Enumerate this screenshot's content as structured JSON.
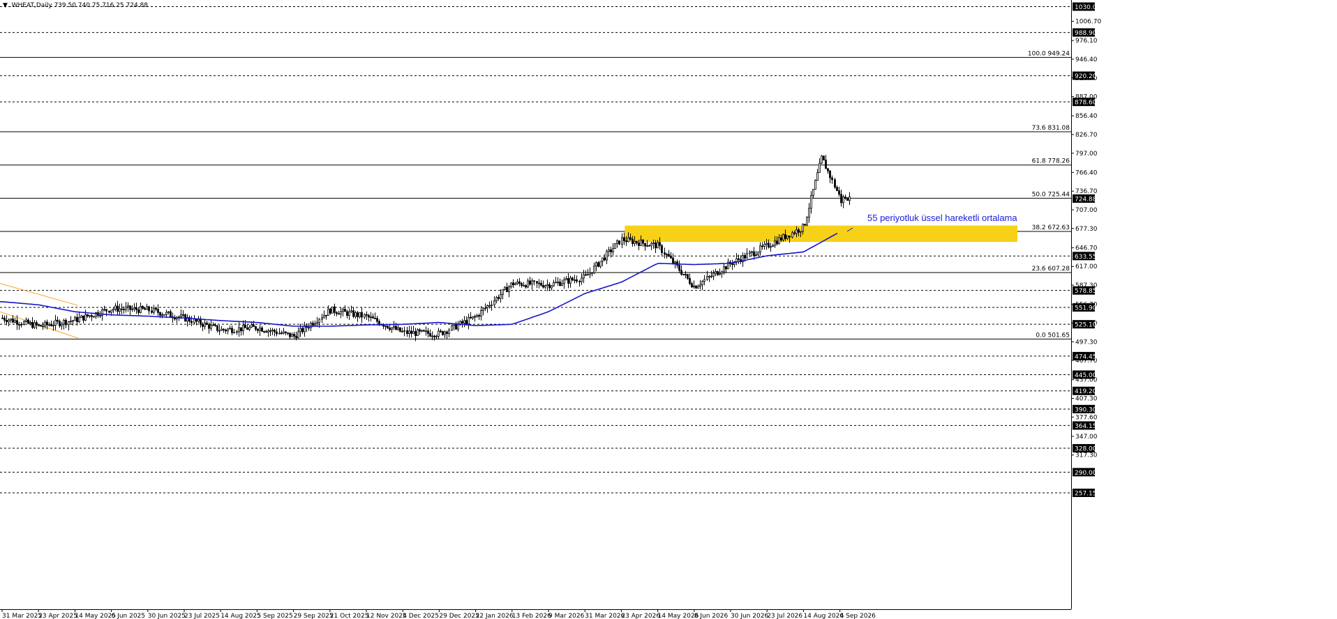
{
  "header": {
    "symbol_text": "▼ .WHEAT,Daily  739.50 740.75 716.25 724.88"
  },
  "colors": {
    "candle": "#000000",
    "ema": "#1414c8",
    "zone": "#f7d117",
    "channel": "#f5a623",
    "grid": "#000000",
    "price_box_bg": "#000000",
    "price_box_fg": "#ffffff",
    "annotation": "#1a1adc"
  },
  "chart_data": {
    "type": "candlestick",
    "title": ".WHEAT,Daily",
    "ylim": [
      257.15,
      1040.0
    ],
    "x_labels": [
      "31 Mar 2025",
      "23 Apr 2025",
      "14 May 2025",
      "6 Jun 2025",
      "30 Jun 2025",
      "23 Jul 2025",
      "14 Aug 2025",
      "5 Sep 2025",
      "29 Sep 2025",
      "21 Oct 2025",
      "12 Nov 2025",
      "4 Dec 2025",
      "29 Dec 2025",
      "22 Jan 2026",
      "13 Feb 2026",
      "9 Mar 2026",
      "31 Mar 2026",
      "23 Apr 2026",
      "14 May 2026",
      "8 Jun 2026",
      "30 Jun 2026",
      "23 Jul 2026",
      "14 Aug 2026",
      "4 Sep 2026"
    ],
    "y_ticks": [
      "1006.70",
      "976.10",
      "946.40",
      "916.70",
      "887.00",
      "856.40",
      "826.70",
      "797.00",
      "766.40",
      "736.70",
      "707.00",
      "677.30",
      "646.70",
      "617.00",
      "587.30",
      "556.70",
      "527.00",
      "497.30",
      "467.70",
      "437.00",
      "407.30",
      "377.60",
      "347.00",
      "317.30"
    ],
    "y_boxed": [
      "1030.00",
      "988.90",
      "920.20",
      "878.60",
      "724.88",
      "633.55",
      "578.85",
      "551.90",
      "525.10",
      "474.45",
      "445.00",
      "419.20",
      "390.30",
      "364.15",
      "328.00",
      "290.00",
      "257.15"
    ],
    "y_dotted_levels": [
      1030.0,
      988.9,
      920.2,
      878.6,
      633.55,
      578.85,
      551.9,
      525.1,
      474.45,
      445.0,
      419.2,
      390.3,
      364.15,
      328.0,
      290.0,
      257.15
    ],
    "fibonacci": [
      {
        "label": "100.0 949.24",
        "value": 949.24
      },
      {
        "label": "73.6 831.08",
        "value": 831.08
      },
      {
        "label": "61.8 778.26",
        "value": 778.26
      },
      {
        "label": "50.0 725.44",
        "value": 725.44
      },
      {
        "label": "38.2 672.63",
        "value": 672.63
      },
      {
        "label": "23.6 607.28",
        "value": 607.28
      },
      {
        "label": "0.0 501.65",
        "value": 501.65
      }
    ],
    "last_price": 724.88,
    "zone": {
      "from_date": "23 Apr 2026",
      "to_date": "4 Sep 2026",
      "low": 656,
      "high": 682
    },
    "annotation": "55 periyotluk üssel hareketli ortalama",
    "ema_period": 55,
    "close_path": [
      [
        "31 Mar 2025",
        535
      ],
      [
        "23 Apr 2025",
        522
      ],
      [
        "14 May 2025",
        532
      ],
      [
        "6 Jun 2025",
        550
      ],
      [
        "30 Jun 2025",
        548
      ],
      [
        "23 Jul 2025",
        535
      ],
      [
        "14 Aug 2025",
        516
      ],
      [
        "5 Sep 2025",
        520
      ],
      [
        "29 Sep 2025",
        506
      ],
      [
        "21 Oct 2025",
        548
      ],
      [
        "12 Nov 2025",
        537
      ],
      [
        "4 Dec 2025",
        512
      ],
      [
        "29 Dec 2025",
        510
      ],
      [
        "22 Jan 2026",
        537
      ],
      [
        "13 Feb 2026",
        590
      ],
      [
        "9 Mar 2026",
        588
      ],
      [
        "31 Mar 2026",
        600
      ],
      [
        "23 Apr 2026",
        660
      ],
      [
        "14 May 2026",
        650
      ],
      [
        "8 Jun 2026",
        585
      ],
      [
        "30 Jun 2026",
        622
      ],
      [
        "23 Jul 2026",
        650
      ],
      [
        "14 Aug 2026",
        680
      ],
      [
        "25 Aug 2026",
        790
      ],
      [
        "4 Sep 2026",
        725
      ]
    ],
    "ema_path": [
      [
        "31 Mar 2025",
        561
      ],
      [
        "23 Apr 2025",
        556
      ],
      [
        "14 May 2025",
        545
      ],
      [
        "6 Jun 2025",
        540
      ],
      [
        "30 Jun 2025",
        538
      ],
      [
        "23 Jul 2025",
        535
      ],
      [
        "14 Aug 2025",
        531
      ],
      [
        "5 Sep 2025",
        528
      ],
      [
        "29 Sep 2025",
        522
      ],
      [
        "21 Oct 2025",
        522
      ],
      [
        "12 Nov 2025",
        524
      ],
      [
        "4 Dec 2025",
        525
      ],
      [
        "29 Dec 2025",
        528
      ],
      [
        "22 Jan 2026",
        523
      ],
      [
        "13 Feb 2026",
        525
      ],
      [
        "9 Mar 2026",
        545
      ],
      [
        "31 Mar 2026",
        574
      ],
      [
        "23 Apr 2026",
        592
      ],
      [
        "14 May 2026",
        622
      ],
      [
        "8 Jun 2026",
        620
      ],
      [
        "30 Jun 2026",
        622
      ],
      [
        "23 Jul 2026",
        634
      ],
      [
        "14 Aug 2026",
        640
      ],
      [
        "4 Sep 2026",
        672
      ]
    ]
  }
}
